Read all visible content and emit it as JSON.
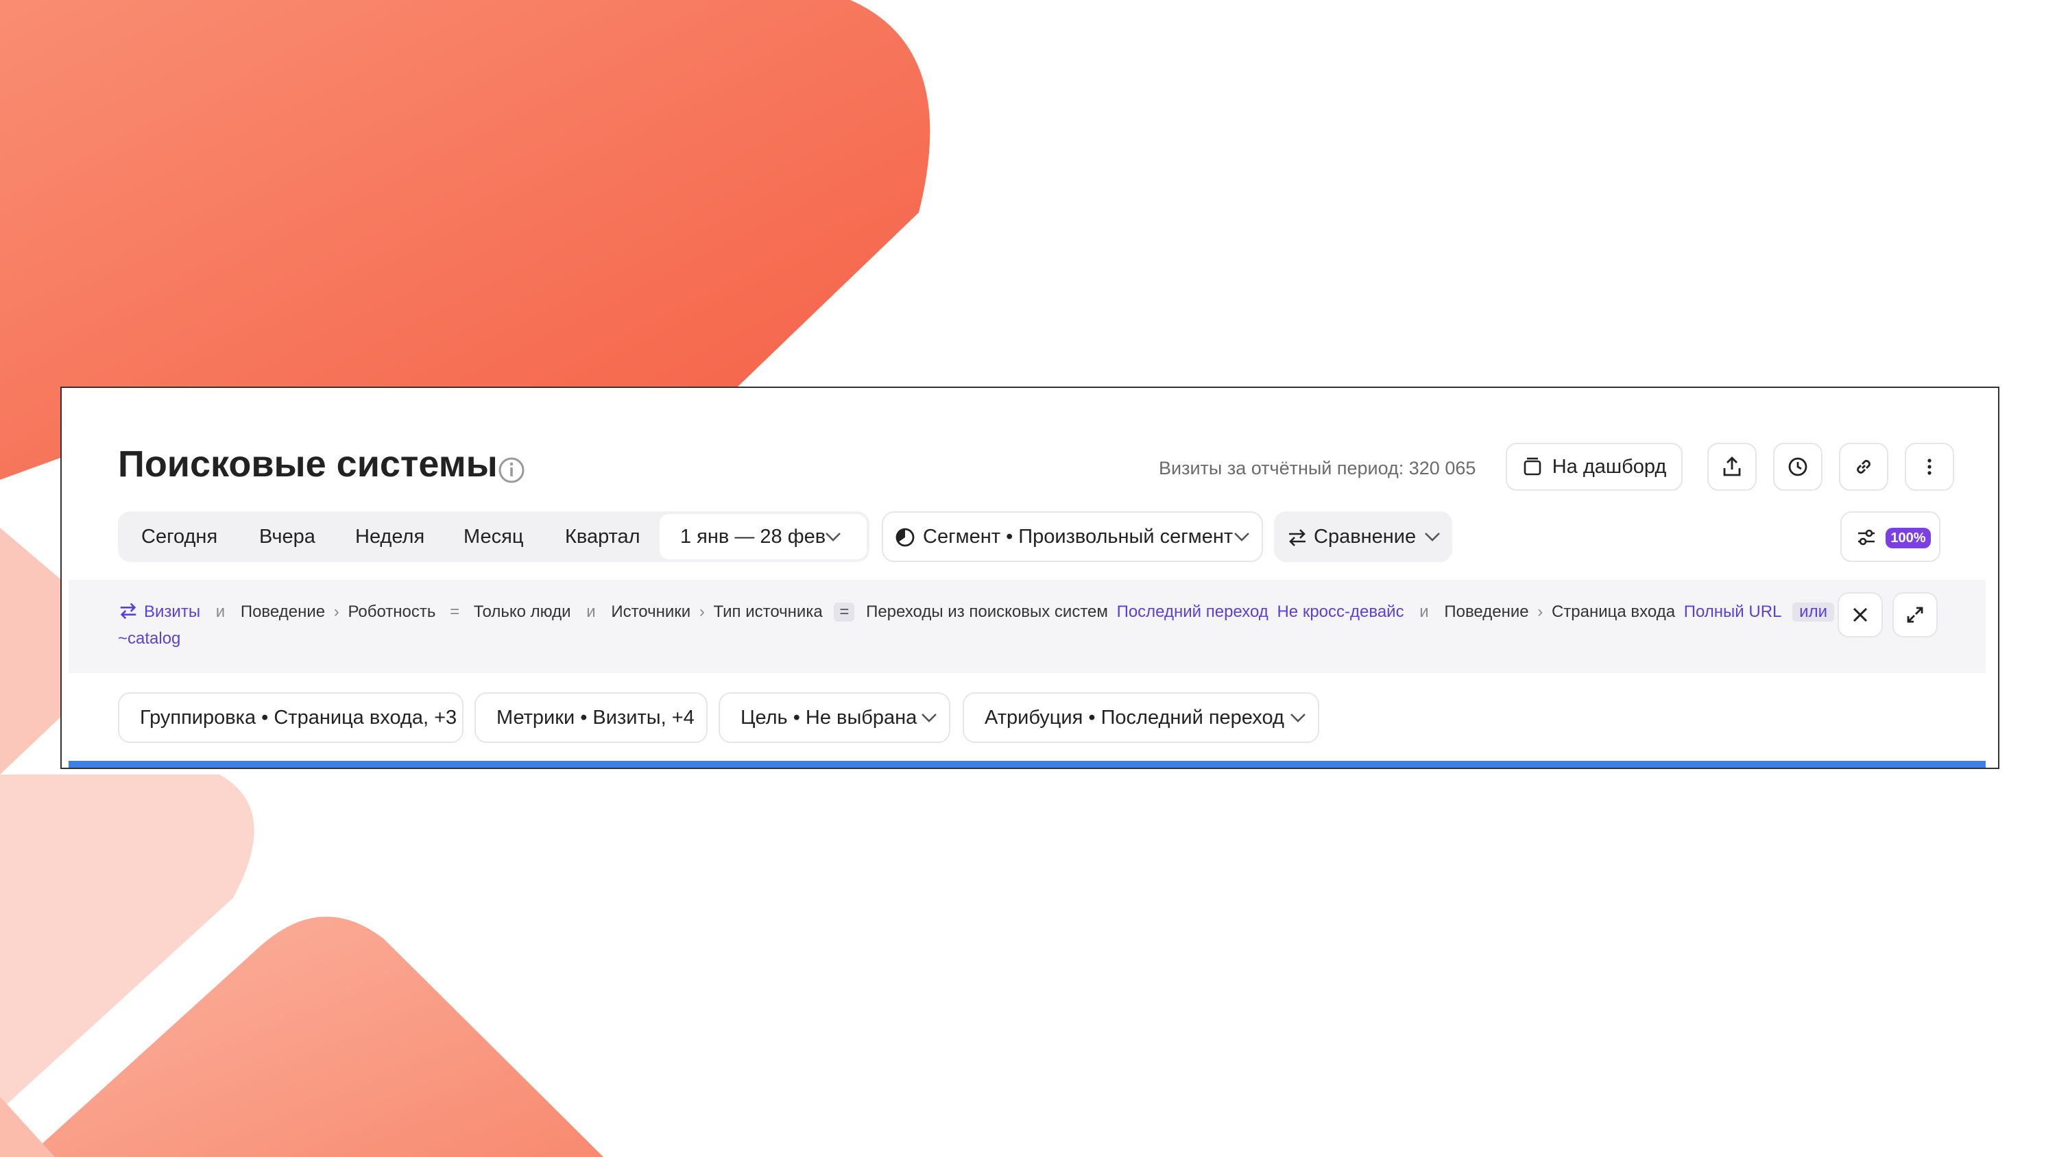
{
  "report": {
    "title": "Поисковые системы",
    "visits_text": "Визиты за отчётный период: 320 065",
    "dashboard_button": "На дашборд",
    "periods": [
      "Сегодня",
      "Вчера",
      "Неделя",
      "Месяц",
      "Квартал"
    ],
    "date_range": "1 янв — 28 фев",
    "segment": "Сегмент • Произвольный сегмент",
    "compare": "Сравнение",
    "sampling_badge": "100%"
  },
  "filter": {
    "visits": "Визиты",
    "and": "и",
    "behavior": "Поведение",
    "robotness": "Роботность",
    "eq": "=",
    "only_people": "Только люди",
    "sources": "Источники",
    "source_type": "Тип источника",
    "search_transitions": "Переходы из поисковых систем",
    "last_click": "Последний переход",
    "not_cross_device": "Не кросс-девайс",
    "entry_page": "Страница входа",
    "full_url": "Полный URL",
    "or": "или",
    "catalog": "~catalog"
  },
  "settings": {
    "grouping": "Группировка • Страница входа, +3",
    "metrics": "Метрики • Визиты, +4",
    "goal": "Цель • Не выбрана",
    "attribution": "Атрибуция • Последний переход"
  },
  "colors": {
    "accent": "#5b3fd9",
    "badge": "#7b3fe4",
    "progress": "#3f7fe8",
    "bg_orange": "#f7775a",
    "annotation_arrow": "#e8202a"
  },
  "icons": [
    "info-icon",
    "dashboard-icon",
    "export-icon",
    "clock-icon",
    "link-icon",
    "more-icon",
    "chevron-down-icon",
    "segment-pie-icon",
    "compare-icon",
    "sliders-icon",
    "close-icon",
    "expand-icon"
  ]
}
